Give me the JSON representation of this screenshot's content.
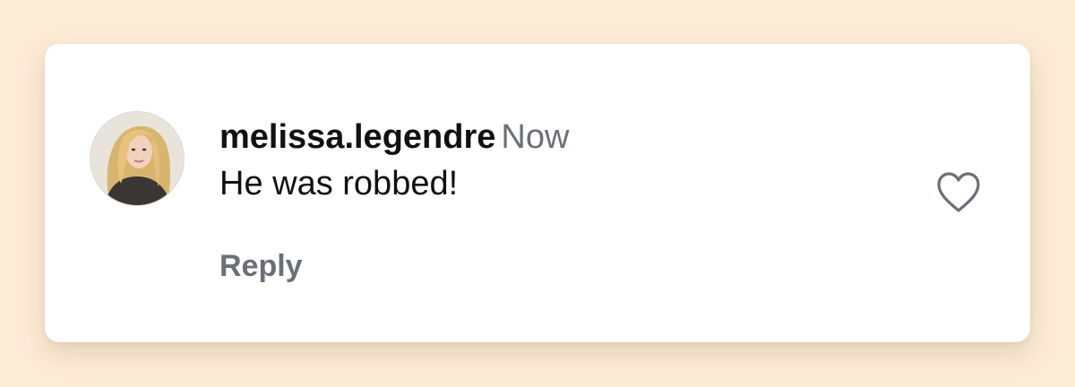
{
  "comment": {
    "username": "melissa.legendre",
    "timestamp": "Now",
    "text": "He was robbed!",
    "reply_label": "Reply",
    "avatar_icon": "user-avatar-photo",
    "like_icon": "heart-outline-icon"
  },
  "colors": {
    "background": "#fcebd6",
    "card": "#ffffff",
    "username": "#111111",
    "muted": "#6b6f78"
  }
}
